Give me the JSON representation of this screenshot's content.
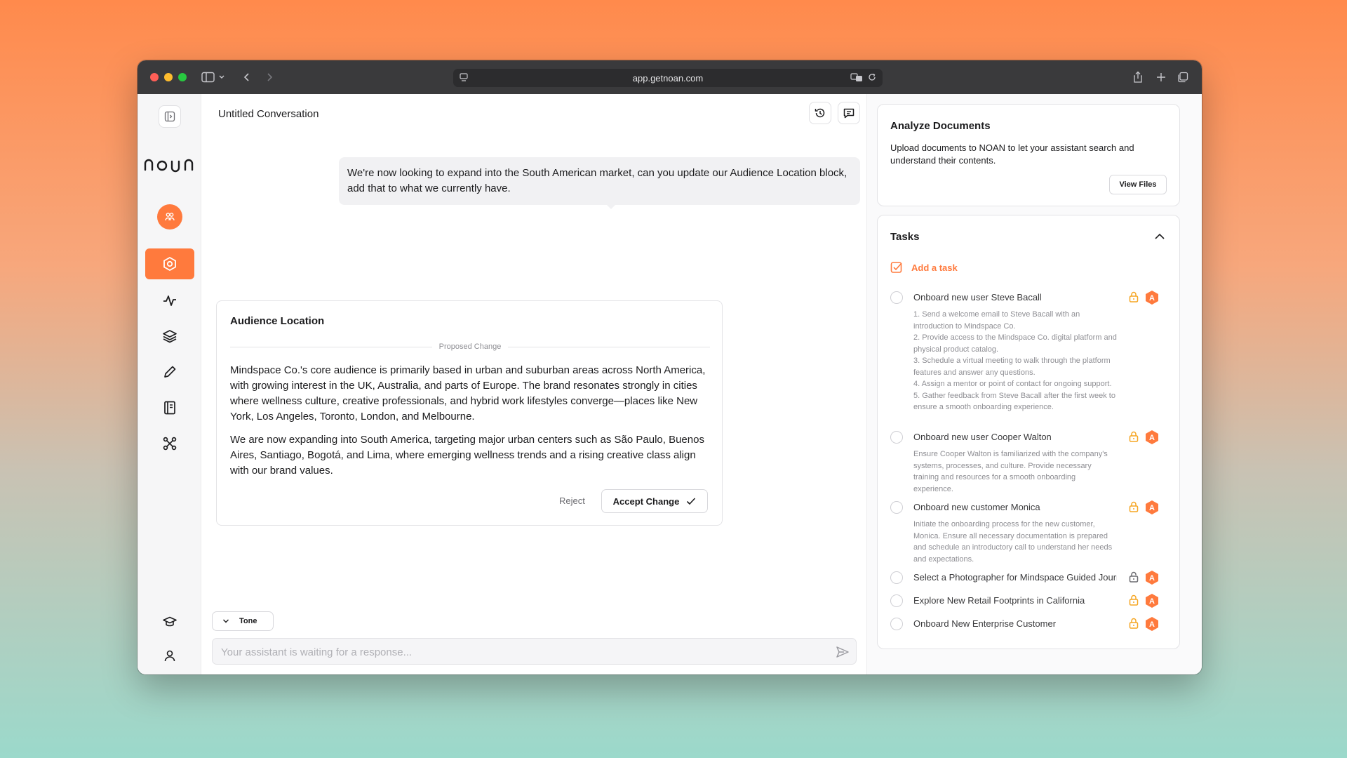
{
  "browser": {
    "url": "app.getnoan.com"
  },
  "sidebar": {
    "logo_text": "noan"
  },
  "conversation": {
    "title": "Untitled Conversation",
    "user_message": "We're now looking to expand into the South American market, can you update our Audience Location block, add that to what we currently have.",
    "proposal": {
      "title": "Audience Location",
      "divider_label": "Proposed Change",
      "paragraph_1": "Mindspace Co.'s core audience is primarily based in urban and suburban areas across North America, with growing interest in the UK, Australia, and parts of Europe. The brand resonates strongly in cities where wellness culture, creative professionals, and hybrid work lifestyles converge—places like New York, Los Angeles, Toronto, London, and Melbourne.",
      "paragraph_2": "We are now expanding into South America, targeting major urban centers such as São Paulo, Buenos Aires, Santiago, Bogotá, and Lima, where emerging wellness trends and a rising creative class align with our brand values.",
      "reject_label": "Reject",
      "accept_label": "Accept Change"
    },
    "tone_label": "Tone",
    "input_placeholder": "Your assistant is waiting for a response..."
  },
  "documents": {
    "title": "Analyze Documents",
    "description": "Upload documents to NOAN to let your assistant search and understand their contents.",
    "button_label": "View Files"
  },
  "tasks": {
    "title": "Tasks",
    "add_label": "Add a task",
    "badge_letter": "A",
    "items": [
      {
        "name": "Onboard new user Steve Bacall",
        "description": "1. Send a welcome email to Steve Bacall with an introduction to Mindspace Co.\n2. Provide access to the Mindspace Co. digital platform and physical product catalog.\n3. Schedule a virtual meeting to walk through the platform features and answer any questions.\n4. Assign a mentor or point of contact for ongoing support.\n5. Gather feedback from Steve Bacall after the first week to ensure a smooth onboarding experience.",
        "lock_color": "#f5a623"
      },
      {
        "name": "Onboard new user Cooper Walton",
        "description": "Ensure Cooper Walton is familiarized with the company's systems, processes, and culture. Provide necessary training and resources for a smooth onboarding experience.",
        "lock_color": "#f5a623"
      },
      {
        "name": "Onboard new customer Monica",
        "description": "Initiate the onboarding process for the new customer, Monica. Ensure all necessary documentation is prepared and schedule an introductory call to understand her needs and expectations.",
        "lock_color": "#f5a623"
      },
      {
        "name": "Select a Photographer for Mindspace Guided Journals",
        "description": "",
        "lock_color": "#6b6b70"
      },
      {
        "name": "Explore New Retail Footprints in California",
        "description": "",
        "lock_color": "#f5a623"
      },
      {
        "name": "Onboard New Enterprise Customer",
        "description": "",
        "lock_color": "#f5a623"
      }
    ]
  },
  "colors": {
    "accent": "#ff7a3d",
    "lock_amber": "#f5a623"
  }
}
